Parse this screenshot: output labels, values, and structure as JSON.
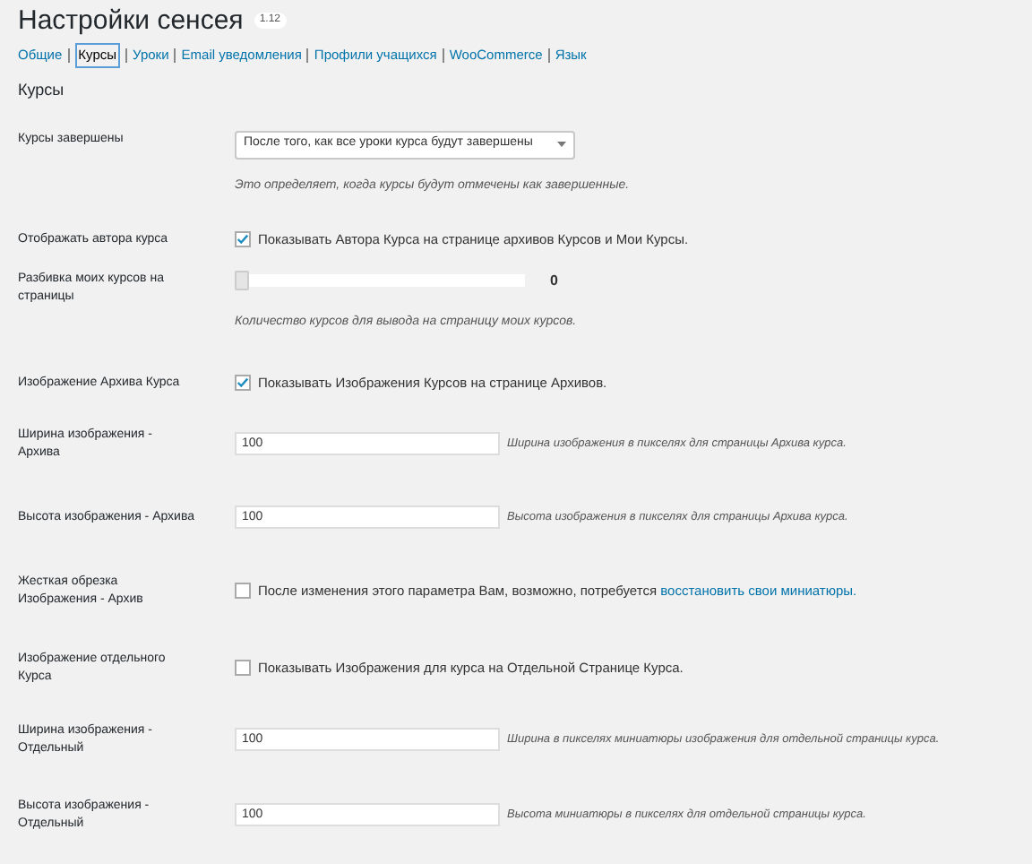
{
  "page": {
    "title": "Настройки сенсея",
    "version": "1.12"
  },
  "tabs": [
    {
      "label": "Общие",
      "selected": false
    },
    {
      "label": "Курсы",
      "selected": true
    },
    {
      "label": "Уроки",
      "selected": false
    },
    {
      "label": "Email уведомления",
      "selected": false
    },
    {
      "label": "Профили учащихся",
      "selected": false
    },
    {
      "label": "WooCommerce",
      "selected": false
    },
    {
      "label": "Язык",
      "selected": false
    }
  ],
  "section": {
    "title": "Курсы"
  },
  "rows": [
    {
      "kind": "select",
      "label": "Курсы завершены",
      "value": "После того, как все уроки курса будут завершены",
      "hint": "Это определяет, когда курсы будут отмечены как завершенные."
    },
    {
      "kind": "checkbox",
      "label": "Отображать автора курса",
      "checked": true,
      "text": "Показывать Автора Курса на странице архивов Курсов и Мои Курсы."
    },
    {
      "kind": "slider",
      "label": "Разбивка моих курсов на страницы",
      "level": 0,
      "reading": "0",
      "hint": "Количество курсов для вывода на страницу моих курсов."
    },
    {
      "kind": "checkbox",
      "label": "Изображение Архива Курса",
      "checked": true,
      "text": "Показывать Изображения Курсов на странице Архивов."
    },
    {
      "kind": "number",
      "label": "Ширина изображения - Архива",
      "value": "100",
      "note": "Ширина изображения в пикселях для страницы Архива курса."
    },
    {
      "kind": "number",
      "label": "Высота изображения - Архива",
      "value": "100",
      "note": "Высота изображения в пикселях для страницы Архива курса."
    },
    {
      "kind": "checkbox",
      "label": "Жесткая обрезка Изображения - Архив",
      "checked": false,
      "text": "После изменения этого параметра Вам, возможно, потребуется",
      "link": "восстановить свои миниатюры."
    },
    {
      "kind": "checkbox",
      "label": "Изображение отдельного Курса",
      "checked": false,
      "text": "Показывать Изображения для курса на Отдельной Странице Курса."
    },
    {
      "kind": "number",
      "label": "Ширина изображения - Отдельный",
      "value": "100",
      "note": "Ширина в пикселях миниатюры изображения для отдельной страницы курса."
    },
    {
      "kind": "number",
      "label": "Высота изображения - Отдельный",
      "value": "100",
      "note": "Высота миниатюры в пикселях для отдельной страницы курса."
    }
  ]
}
